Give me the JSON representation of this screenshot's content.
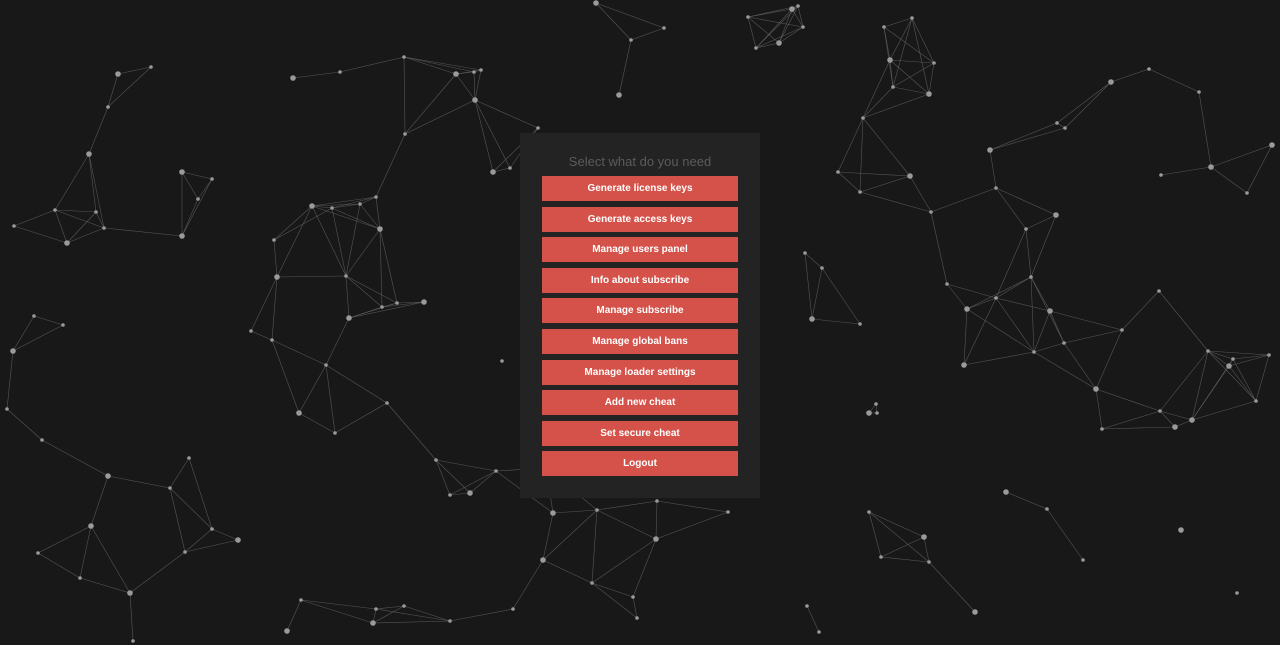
{
  "panel": {
    "title": "Select what do you need",
    "buttons": [
      {
        "label": "Generate license keys"
      },
      {
        "label": "Generate access keys"
      },
      {
        "label": "Manage users panel"
      },
      {
        "label": "Info about subscribe"
      },
      {
        "label": "Manage subscribe"
      },
      {
        "label": "Manage global bans"
      },
      {
        "label": "Manage loader settings"
      },
      {
        "label": "Add new cheat"
      },
      {
        "label": "Set secure cheat"
      },
      {
        "label": "Logout"
      }
    ]
  },
  "colors": {
    "background": "#181818",
    "panel": "#232323",
    "button": "#d4524a",
    "button_text": "#ffffff",
    "title_text": "#5b5b5b"
  }
}
